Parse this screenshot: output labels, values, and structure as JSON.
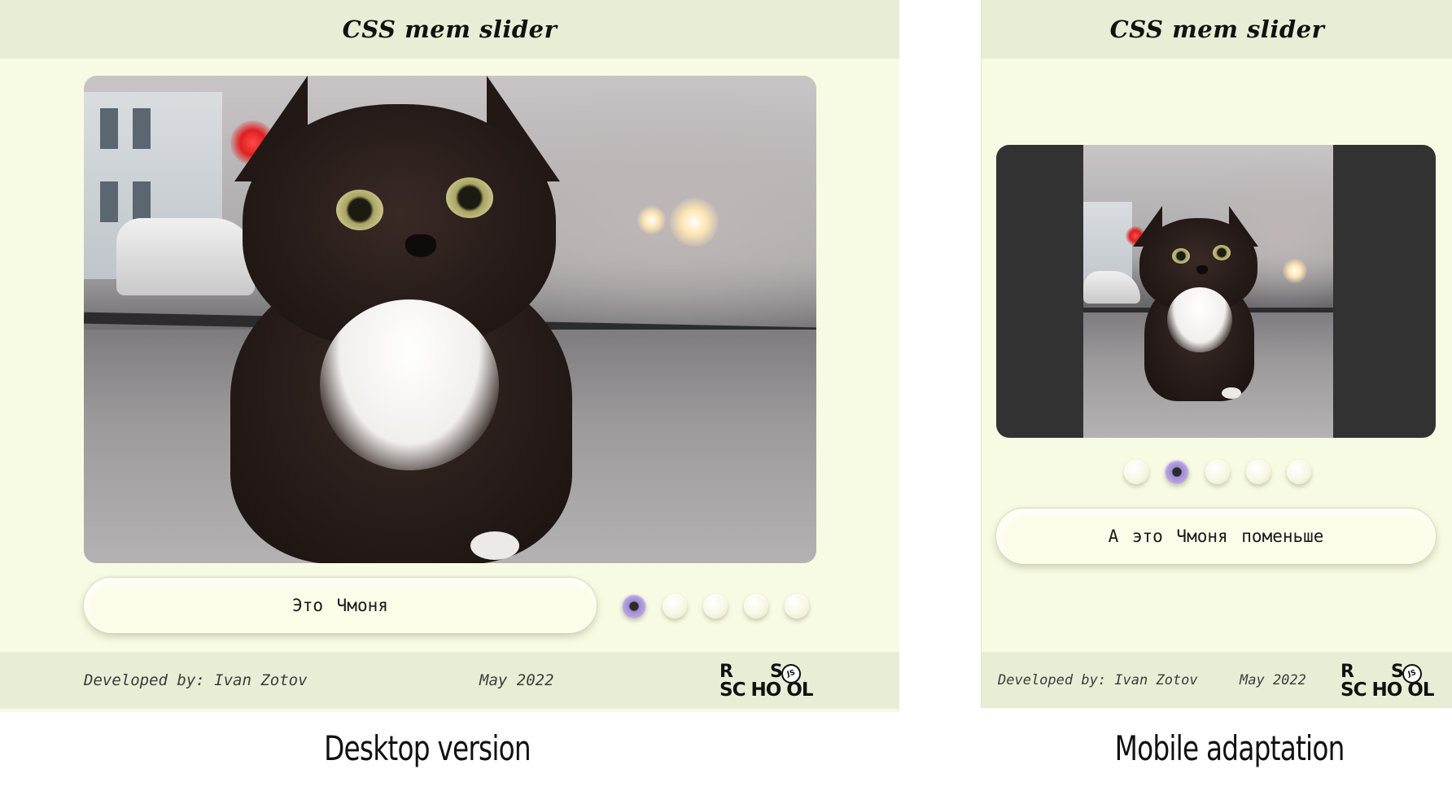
{
  "desktop": {
    "header": {
      "title": "CSS mem slider"
    },
    "slide_image": {
      "alt": "cat-on-dashboard"
    },
    "caption": {
      "text": "Это Чмоня"
    },
    "slider": {
      "dot_count": 5,
      "active_index": 0
    },
    "footer": {
      "developer": "Developed by: Ivan Zotov",
      "date": "May 2022",
      "logo": {
        "line1_r": "R",
        "line1_s": "S",
        "line2": "SC HO OL",
        "badge": "JS"
      }
    },
    "label": "Desktop version"
  },
  "mobile": {
    "header": {
      "title": "CSS mem slider"
    },
    "slide_image": {
      "alt": "cat-on-dashboard-small"
    },
    "caption": {
      "text": "А это Чмоня поменьше"
    },
    "slider": {
      "dot_count": 5,
      "active_index": 1
    },
    "footer": {
      "developer": "Developed by: Ivan Zotov",
      "date": "May 2022",
      "logo": {
        "line1_r": "R",
        "line1_s": "S",
        "line2": "SC HO OL",
        "badge": "JS"
      }
    },
    "label": "Mobile adaptation"
  },
  "colors": {
    "panel_bg": "#f8fbe3",
    "bar_bg": "#e8eed5",
    "active_dot": "#bba9e3",
    "mobile_frame": "#323232"
  }
}
